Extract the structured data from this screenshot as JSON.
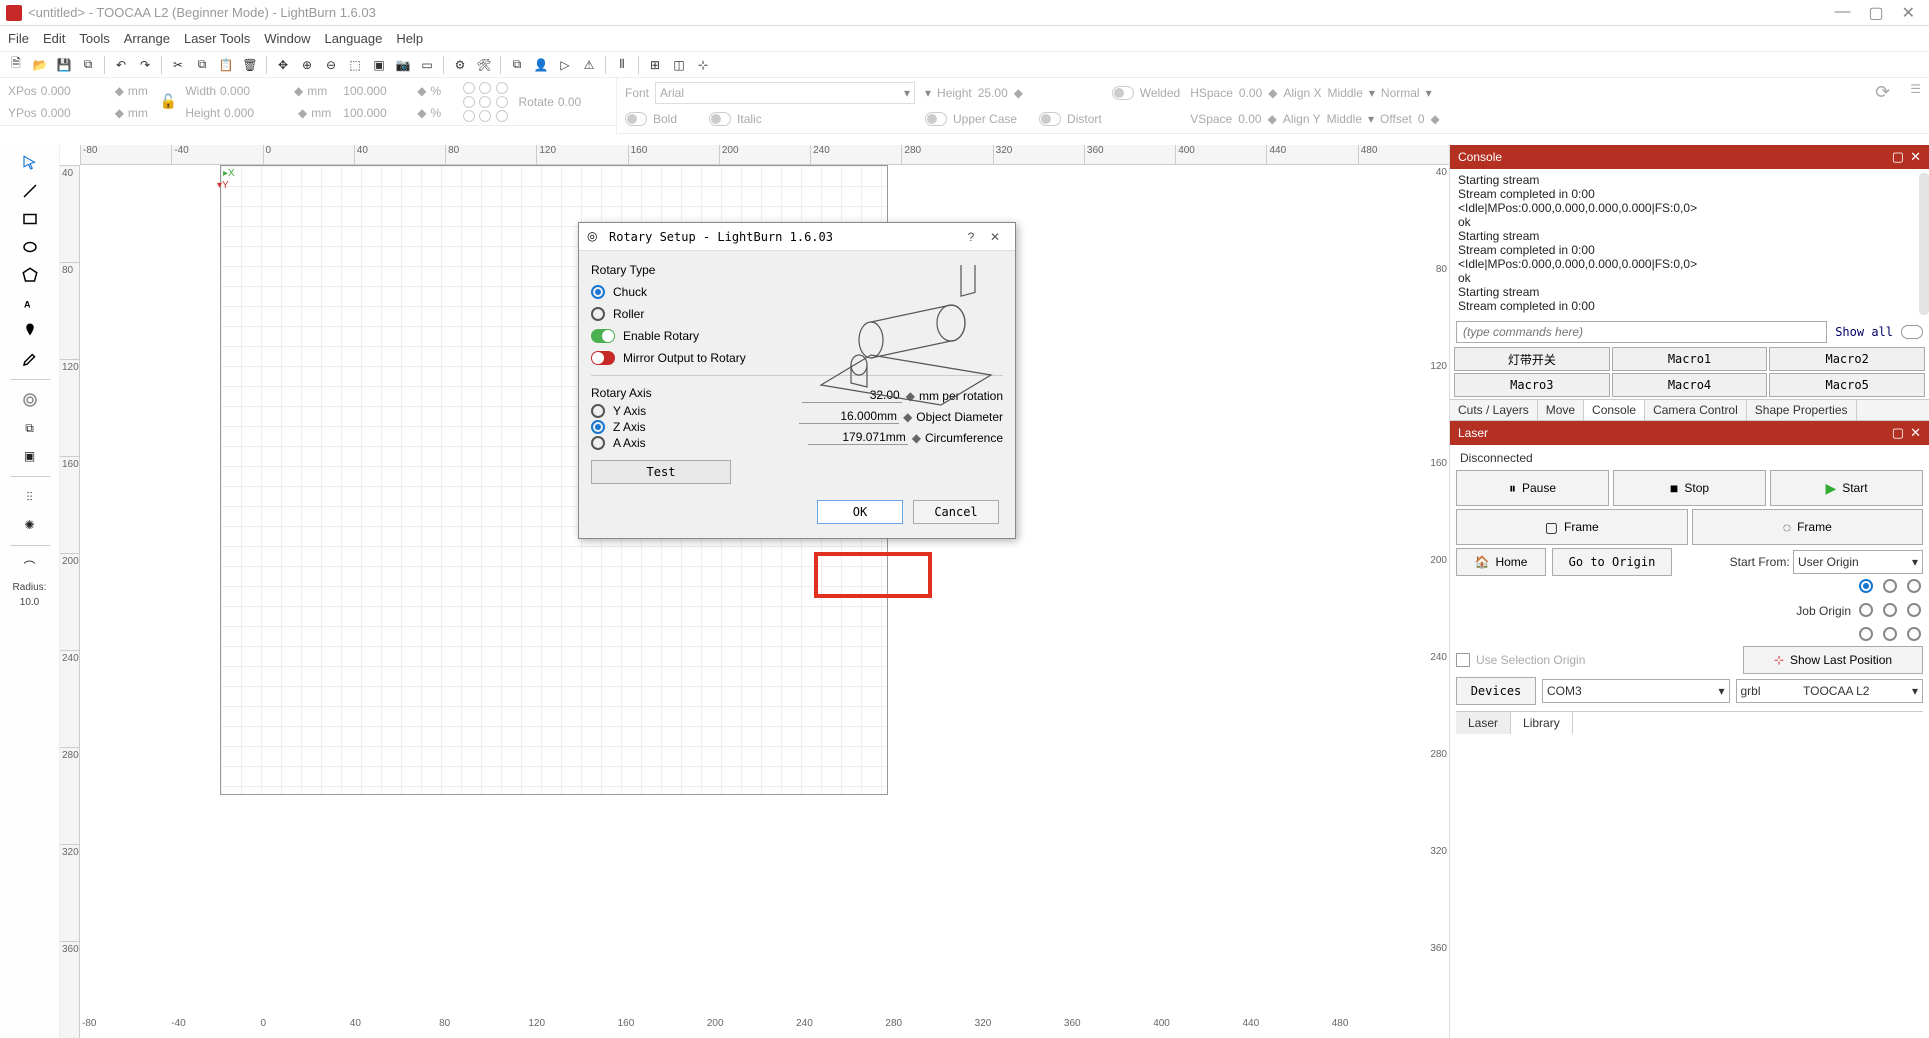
{
  "window": {
    "title": "<untitled> - TOOCAA L2 (Beginner Mode) - LightBurn 1.6.03"
  },
  "menu": [
    "File",
    "Edit",
    "Tools",
    "Arrange",
    "Laser Tools",
    "Window",
    "Language",
    "Help"
  ],
  "props": {
    "xpos_label": "XPos",
    "xpos": "0.000",
    "ypos_label": "YPos",
    "ypos": "0.000",
    "width_label": "Width",
    "width": "0.000",
    "height_label": "Height",
    "height": "0.000",
    "pct1": "100.000",
    "pct2": "100.000",
    "rotate_label": "Rotate",
    "rotate": "0.00",
    "unit_mm": "mm",
    "unit_pct": "%"
  },
  "font": {
    "font_label": "Font",
    "font_name": "Arial",
    "height_label": "Height",
    "height_val": "25.00",
    "bold": "Bold",
    "upper": "Upper Case",
    "welded": "Welded",
    "italic": "Italic",
    "distort": "Distort",
    "hspace_label": "HSpace",
    "hspace": "0.00",
    "vspace_label": "VSpace",
    "vspace": "0.00",
    "alignx_label": "Align X",
    "alignx": "Middle",
    "aligny_label": "Align Y",
    "aligny": "Middle",
    "normal": "Normal",
    "offset_label": "Offset",
    "offset": "0"
  },
  "ruler_h": [
    "-80",
    "-40",
    "0",
    "40",
    "80",
    "120",
    "160",
    "200",
    "240",
    "280",
    "320",
    "360",
    "400",
    "440",
    "480"
  ],
  "ruler_v": [
    "40",
    "80",
    "120",
    "160",
    "200",
    "240",
    "280",
    "320",
    "360"
  ],
  "ruler_v2": [
    "40",
    "80",
    "120",
    "160",
    "200",
    "240",
    "280",
    "320",
    "360"
  ],
  "ruler_h2": [
    "-80",
    "-40",
    "0",
    "40",
    "80",
    "120",
    "160",
    "200",
    "240",
    "280",
    "320",
    "360",
    "400",
    "440",
    "480"
  ],
  "tools": {
    "radius_label": "Radius:",
    "radius_val": "10.0"
  },
  "console": {
    "title": "Console",
    "lines": [
      "Starting stream",
      "Stream completed in 0:00",
      "<Idle|MPos:0.000,0.000,0.000,0.000|FS:0,0>",
      "ok",
      "Starting stream",
      "Stream completed in 0:00",
      "<Idle|MPos:0.000,0.000,0.000,0.000|FS:0,0>",
      "ok",
      "Starting stream",
      "Stream completed in 0:00"
    ],
    "cmd_placeholder": "(type commands here)",
    "showall": "Show all",
    "macros": [
      "灯带开关",
      "Macro1",
      "Macro2",
      "Macro3",
      "Macro4",
      "Macro5"
    ],
    "tabs": [
      "Cuts / Layers",
      "Move",
      "Console",
      "Camera Control",
      "Shape Properties"
    ]
  },
  "laser": {
    "title": "Laser",
    "status": "Disconnected",
    "pause": "Pause",
    "stop": "Stop",
    "start": "Start",
    "frame": "Frame",
    "frame2": "Frame",
    "home": "Home",
    "goto": "Go to Origin",
    "startfrom_label": "Start From:",
    "startfrom": "User Origin",
    "joborigin_label": "Job Origin",
    "usesel": "Use Selection Origin",
    "showlast": "Show Last Position",
    "devices": "Devices",
    "port": "COM3",
    "device": "TOOCAA L2",
    "tab_laser": "Laser",
    "tab_library": "Library"
  },
  "dialog": {
    "title": "Rotary Setup - LightBurn 1.6.03",
    "type_label": "Rotary Type",
    "chuck": "Chuck",
    "roller": "Roller",
    "enable": "Enable Rotary",
    "mirror": "Mirror Output to Rotary",
    "axis_label": "Rotary Axis",
    "yaxis": "Y Axis",
    "zaxis": "Z Axis",
    "aaxis": "A Axis",
    "mm_per_rot": "32.00",
    "mm_per_rot_label": "mm per rotation",
    "obj_dia": "16.000mm",
    "obj_dia_label": "Object Diameter",
    "circ": "179.071mm",
    "circ_label": "Circumference",
    "test": "Test",
    "ok": "OK",
    "cancel": "Cancel"
  }
}
